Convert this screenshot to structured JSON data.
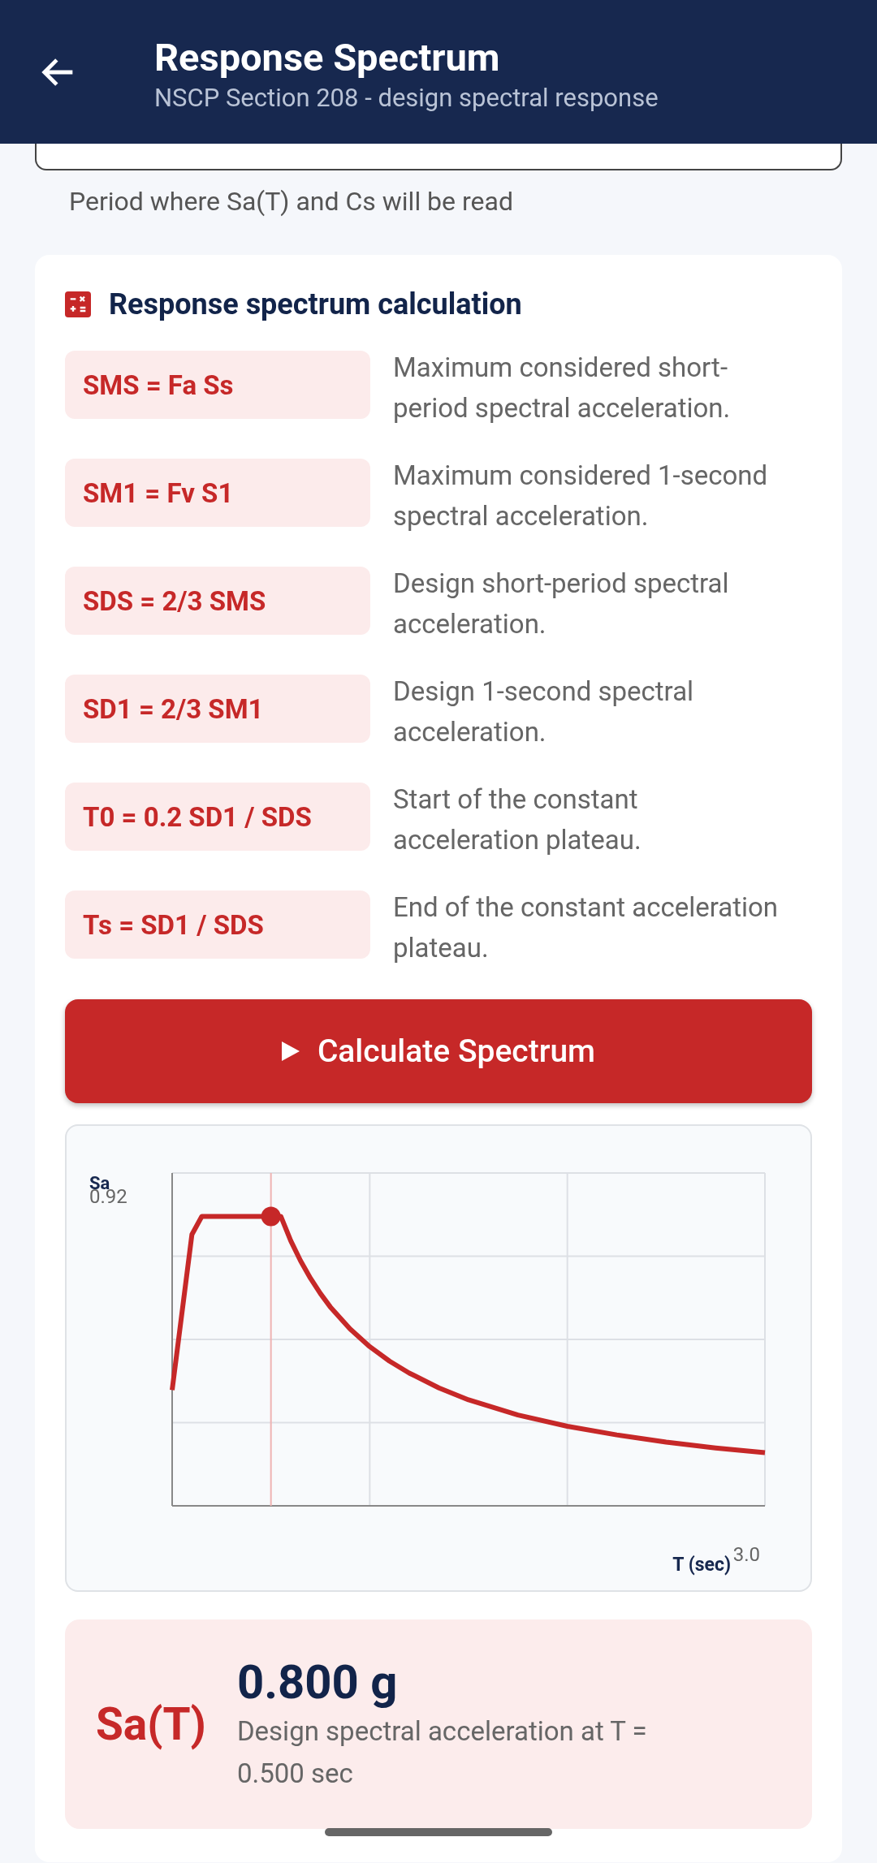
{
  "app_bar": {
    "title": "Response Spectrum",
    "subtitle": "NSCP Section 208 - design spectral response"
  },
  "period_field": {
    "helper": "Period where Sa(T) and Cs will be read"
  },
  "calculation_card": {
    "title": "Response spectrum calculation",
    "formulas": [
      {
        "formula": "SMS = Fa Ss",
        "description": "Maximum considered short-period spectral acceleration."
      },
      {
        "formula": "SM1 = Fv S1",
        "description": "Maximum considered 1-second spectral acceleration."
      },
      {
        "formula": "SDS = 2/3 SMS",
        "description": "Design short-period spectral acceleration."
      },
      {
        "formula": "SD1 = 2/3 SM1",
        "description": "Design 1-second spectral acceleration."
      },
      {
        "formula": "T0 = 0.2 SD1 / SDS",
        "description": "Start of the constant acceleration plateau."
      },
      {
        "formula": "Ts = SD1 / SDS",
        "description": "End of the constant acceleration plateau."
      }
    ],
    "button": "Calculate Spectrum",
    "chart": {
      "y_label": "Sa",
      "y_max_label": "0.92",
      "x_label": "T (sec)",
      "x_max_label": "3.0"
    },
    "result": {
      "symbol": "Sa(T)",
      "value": "0.800 g",
      "description": "Design spectral acceleration at T = 0.500 sec"
    }
  }
}
